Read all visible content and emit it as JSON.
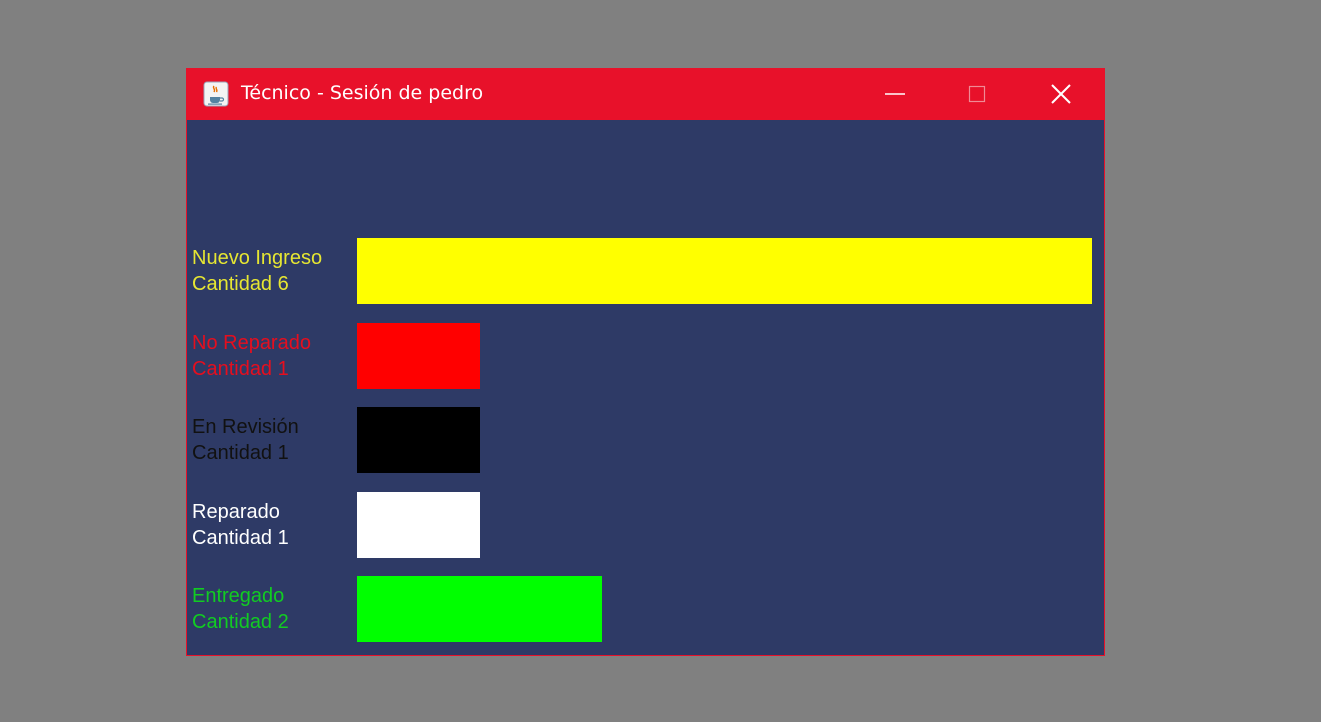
{
  "window": {
    "title": "Técnico - Sesión de pedro",
    "app_icon": "java-cup-icon",
    "titlebar_color": "#e8112a",
    "background_color": "#2e3a66"
  },
  "controls": {
    "minimize_icon": "minimize-icon",
    "maximize_icon": "maximize-icon",
    "close_icon": "close-icon"
  },
  "chart_data": {
    "type": "bar",
    "orientation": "horizontal",
    "categories": [
      "Nuevo Ingreso",
      "No Reparado",
      "En Revisión",
      "Reparado",
      "Entregado"
    ],
    "values": [
      6,
      1,
      1,
      1,
      2
    ],
    "value_labels": [
      "Cantidad 6",
      "Cantidad 1",
      "Cantidad 1",
      "Cantidad 1",
      "Cantidad 2"
    ],
    "colors": [
      "#ffff00",
      "#ff0000",
      "#000000",
      "#ffffff",
      "#00ff00"
    ],
    "label_colors": [
      "#e6e632",
      "#e60e1e",
      "#111111",
      "#ffffff",
      "#11cc22"
    ],
    "xlim": [
      0,
      6
    ],
    "grid": false,
    "legend": "none"
  }
}
